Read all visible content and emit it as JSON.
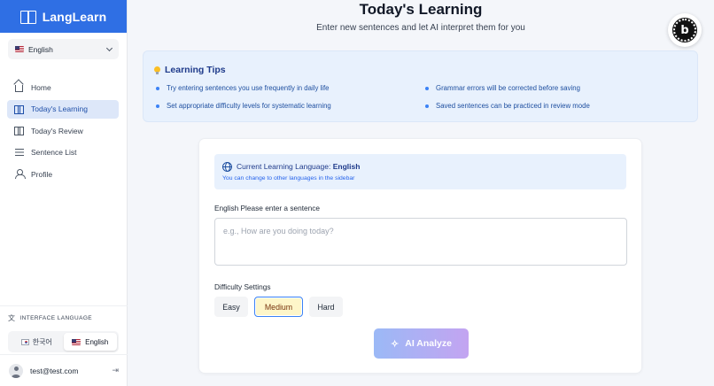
{
  "brand": {
    "name": "LangLearn",
    "icon": "book-icon"
  },
  "sidebar": {
    "learning_language": {
      "value": "English",
      "flag": "us-flag"
    },
    "nav": [
      {
        "label": "Home",
        "icon": "home-icon",
        "active": false
      },
      {
        "label": "Today's Learning",
        "icon": "book-icon",
        "active": true
      },
      {
        "label": "Today's Review",
        "icon": "book-icon",
        "active": false
      },
      {
        "label": "Sentence List",
        "icon": "list-icon",
        "active": false
      },
      {
        "label": "Profile",
        "icon": "user-icon",
        "active": false
      }
    ],
    "interface_language": {
      "label": "INTERFACE LANGUAGE",
      "options": [
        {
          "label": "한국어",
          "flag": "kr-flag",
          "active": false
        },
        {
          "label": "English",
          "flag": "us-flag",
          "active": true
        }
      ]
    },
    "user": {
      "email": "test@test.com"
    }
  },
  "header": {
    "title": "Today's Learning",
    "subtitle": "Enter new sentences and let AI interpret them for you"
  },
  "tips": {
    "title": "Learning Tips",
    "items": [
      "Try entering sentences you use frequently in daily life",
      "Grammar errors will be corrected before saving",
      "Set appropriate difficulty levels for systematic learning",
      "Saved sentences can be practiced in review mode"
    ]
  },
  "form": {
    "current_language_prefix": "Current Learning Language: ",
    "current_language": "English",
    "language_hint": "You can change to other languages in the sidebar",
    "sentence_label": "English Please enter a sentence",
    "sentence_placeholder": "e.g., How are you doing today?",
    "sentence_value": "",
    "difficulty_label": "Difficulty Settings",
    "difficulty_options": [
      "Easy",
      "Medium",
      "Hard"
    ],
    "difficulty_selected": "Medium",
    "analyze_label": "AI Analyze"
  },
  "colors": {
    "brand": "#2f6fe4",
    "active_nav_bg": "#dde7f9",
    "tips_bg": "#e8f1fd",
    "selected_difficulty_bg": "#fef6c9",
    "selected_difficulty_border": "#3b82f6"
  }
}
